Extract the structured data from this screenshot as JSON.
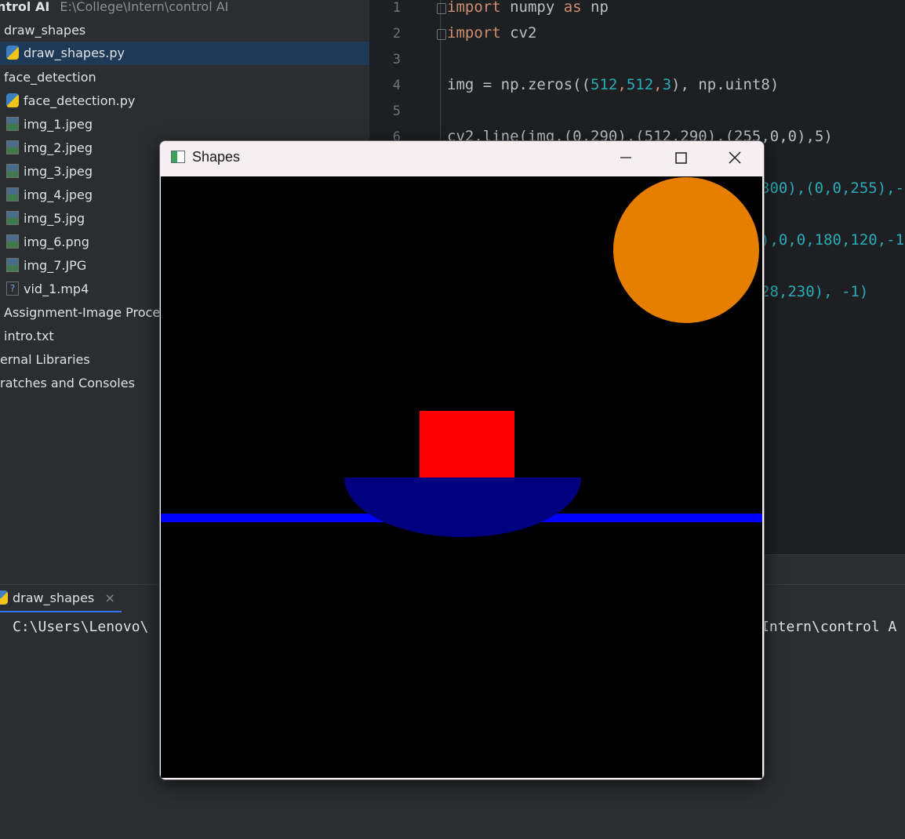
{
  "project": {
    "root_name": "ntrol AI",
    "root_path": "E:\\College\\Intern\\control AI",
    "items": [
      {
        "label": "draw_shapes",
        "kind": "folder"
      },
      {
        "label": "draw_shapes.py",
        "kind": "py",
        "selected": true
      },
      {
        "label": "face_detection",
        "kind": "folder"
      },
      {
        "label": "face_detection.py",
        "kind": "py"
      },
      {
        "label": "img_1.jpeg",
        "kind": "img"
      },
      {
        "label": "img_2.jpeg",
        "kind": "img"
      },
      {
        "label": "img_3.jpeg",
        "kind": "img"
      },
      {
        "label": "img_4.jpeg",
        "kind": "img"
      },
      {
        "label": "img_5.jpg",
        "kind": "img"
      },
      {
        "label": "img_6.png",
        "kind": "img"
      },
      {
        "label": "img_7.JPG",
        "kind": "img"
      },
      {
        "label": "vid_1.mp4",
        "kind": "vid"
      },
      {
        "label": "Assignment-Image Proce",
        "kind": "folder"
      },
      {
        "label": "intro.txt",
        "kind": "folder"
      },
      {
        "label": "ernal Libraries",
        "kind": "folder"
      },
      {
        "label": "ratches and Consoles",
        "kind": "folder"
      }
    ]
  },
  "editor": {
    "line_numbers": [
      "1",
      "2",
      "3",
      "4",
      "5",
      "6"
    ],
    "line1": {
      "kw": "import",
      "mod": " numpy ",
      "kw2": "as",
      "alias": " np"
    },
    "line2": {
      "kw": "import",
      "mod": " cv2"
    },
    "line4": {
      "a": "img = np.zeros((",
      "n1": "512",
      "c1": ",",
      "n2": "512",
      "c2": ",",
      "n3": "3",
      "b": "), np.uint8)"
    },
    "line6": {
      "text": "cv2.line(img,(0,290),(512,290),(255,0,0),5)"
    },
    "line7_tail": "300),(0,0,255),-",
    "line8_tail": "),0,0,180,120,-1",
    "line9_tail": "28,230), -1)"
  },
  "run": {
    "tab_label": "draw_shapes",
    "close_glyph": "×",
    "output_left": "C:\\Users\\Lenovo\\",
    "output_right": "Intern\\control A"
  },
  "shapes_window": {
    "title": "Shapes",
    "minimize_glyph": "—",
    "close_glyph": "✕"
  },
  "colors": {
    "line_blue": "#0000ff",
    "rect_red": "#ff0000",
    "ellipse_navy": "#000080",
    "circle_orange": "#e67e00"
  }
}
